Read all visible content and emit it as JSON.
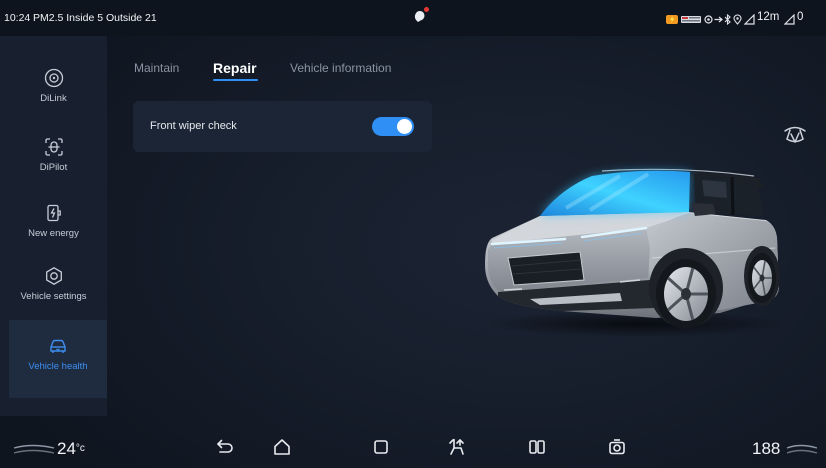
{
  "status_bar": {
    "time": "10:24",
    "air_quality": "PM2.5 Inside 5 Outside 21",
    "distance": "12m",
    "trailing_value": "0",
    "icons": [
      "notification-icon",
      "charging-status-icon",
      "brand-badge-icon",
      "record-icon",
      "usb-icon",
      "bluetooth-icon",
      "location-icon",
      "signal-icon",
      "signal-icon"
    ]
  },
  "sidebar": {
    "items": [
      {
        "label": "DiLink",
        "icon": "dilink-icon",
        "active": false
      },
      {
        "label": "DiPilot",
        "icon": "dipilot-icon",
        "active": false
      },
      {
        "label": "New energy",
        "icon": "battery-bolt-icon",
        "active": false
      },
      {
        "label": "Vehicle settings",
        "icon": "hexagon-settings-icon",
        "active": false
      },
      {
        "label": "Vehicle health",
        "icon": "car-health-icon",
        "active": true
      }
    ]
  },
  "tabs": [
    {
      "label": "Maintain",
      "active": false
    },
    {
      "label": "Repair",
      "active": true
    },
    {
      "label": "Vehicle information",
      "active": false
    }
  ],
  "repair_card": {
    "label": "Front wiper check",
    "toggle_on": true
  },
  "right_icon": "wiper-icon",
  "bottom_bar": {
    "driver_temp": "24",
    "driver_temp_unit": "°c",
    "passenger_temp": "188",
    "icons": [
      "back-icon",
      "home-icon",
      "recent-apps-icon",
      "seat-icon",
      "split-screen-icon",
      "panorama-camera-icon"
    ]
  },
  "colors": {
    "accent": "#2f8ff5",
    "background": "#141b28",
    "sidebar": "#182030",
    "active_item": "#1f2c40",
    "card": "#1c2535",
    "windshield_highlight": "#35c3ff",
    "notification_dot": "#e53935"
  }
}
